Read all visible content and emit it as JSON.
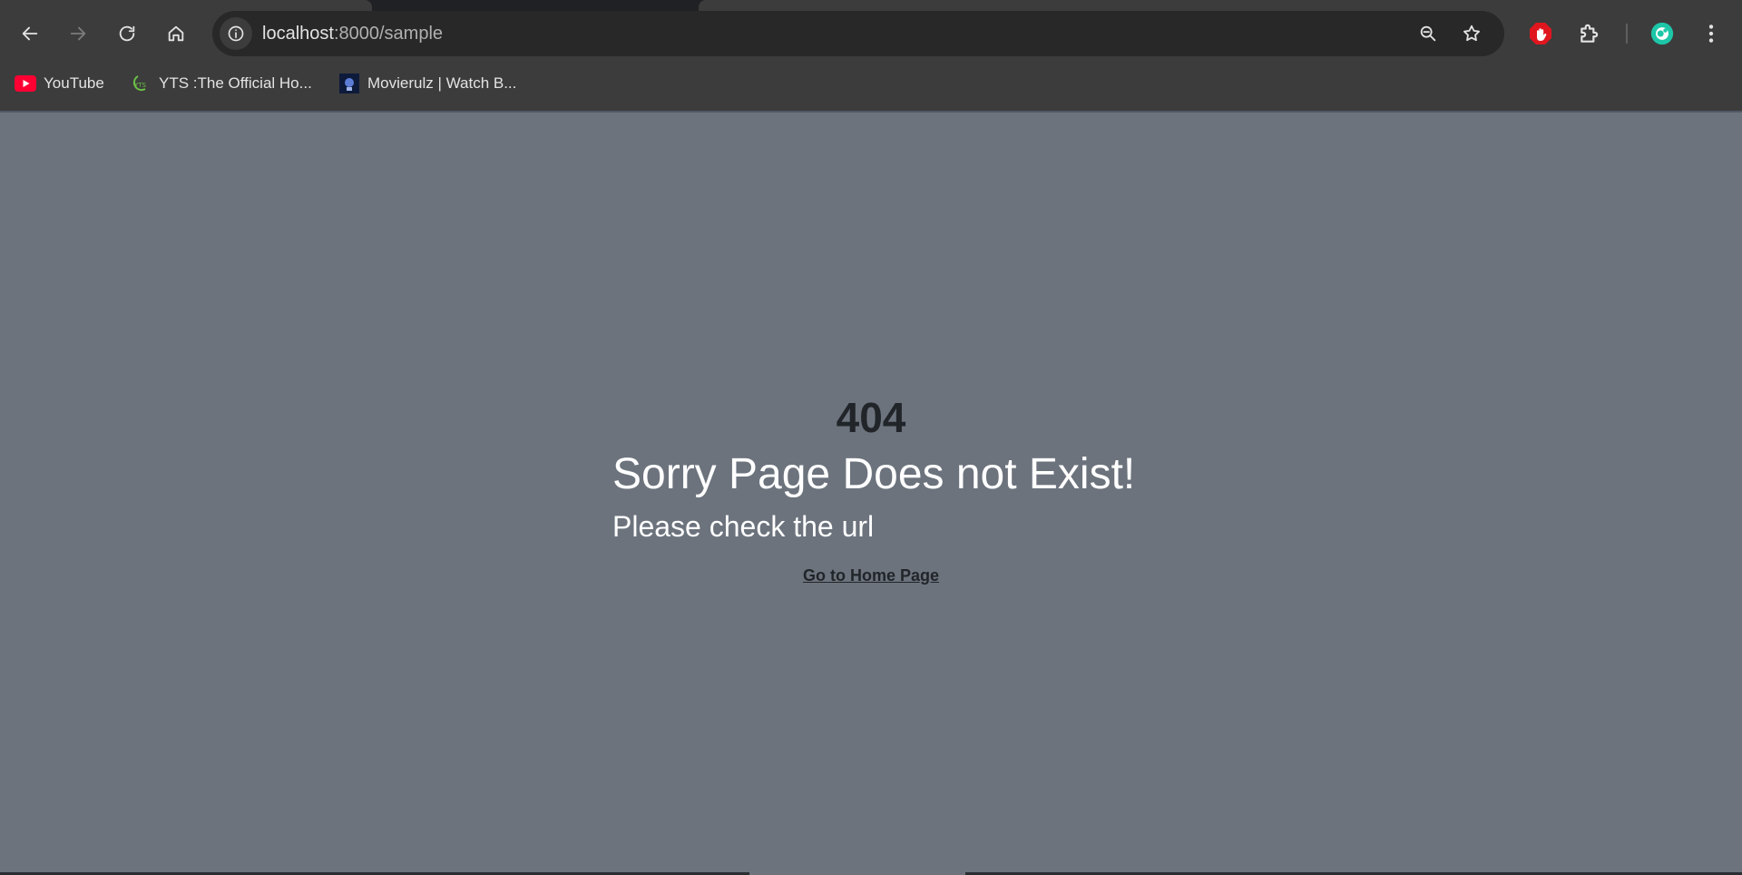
{
  "browser": {
    "address_bar": {
      "host": "localhost",
      "path": ":8000/sample"
    },
    "nav": {
      "back_icon": "arrow-left-icon",
      "forward_icon": "arrow-right-icon",
      "reload_icon": "reload-icon",
      "home_icon": "home-icon"
    },
    "toolbar_icons": [
      "zoom-icon",
      "star-icon",
      "adblock-icon",
      "extensions-icon",
      "profile-avatar-icon",
      "menu-icon"
    ],
    "bookmarks": [
      {
        "label": "YouTube",
        "icon": "youtube-icon"
      },
      {
        "label": "YTS :The Official Ho...",
        "icon": "yts-icon"
      },
      {
        "label": "Movierulz | Watch B...",
        "icon": "movierulz-icon"
      }
    ],
    "colors": {
      "chrome_bg": "#3c3c3c",
      "omnibox_bg": "#282828",
      "adblock_red": "#e0161f",
      "avatar_teal": "#1ec6a8",
      "youtube_red": "#ff0033"
    }
  },
  "page": {
    "error_code": "404",
    "title": "Sorry Page Does not Exist!",
    "subtitle": "Please check the url",
    "home_link": "Go to Home Page",
    "colors": {
      "background": "#6c737d",
      "dark_text": "#212529",
      "light_text": "#ffffff"
    }
  }
}
